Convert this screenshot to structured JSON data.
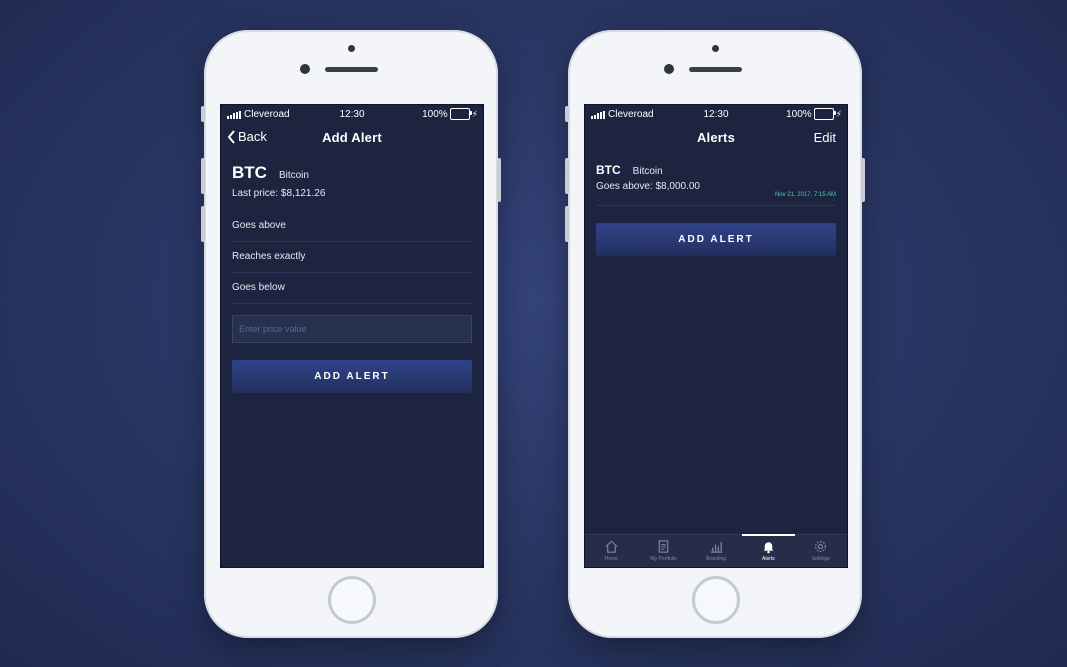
{
  "status_bar": {
    "carrier": "Cleveroad",
    "time": "12:30",
    "battery": "100%"
  },
  "add_alert_screen": {
    "nav": {
      "back_label": "Back",
      "title": "Add Alert"
    },
    "coin": {
      "ticker": "BTC",
      "name": "Bitcoin",
      "last_price": "Last price: $8,121.26"
    },
    "options": [
      "Goes above",
      "Reaches exactly",
      "Goes below"
    ],
    "price_input": {
      "placeholder": "Enter price value",
      "value": ""
    },
    "add_button": "ADD ALERT"
  },
  "alerts_screen": {
    "nav": {
      "title": "Alerts",
      "edit_label": "Edit"
    },
    "alerts": [
      {
        "ticker": "BTC",
        "name": "Bitcoin",
        "condition": "Goes above: $8,000.00",
        "date": "Nov 21, 2017, 7:15 AM"
      }
    ],
    "add_button": "ADD ALERT",
    "tabs": [
      {
        "label": "Home",
        "icon": "home-icon",
        "active": false
      },
      {
        "label": "My Portfolio",
        "icon": "portfolio-icon",
        "active": false
      },
      {
        "label": "Branding",
        "icon": "chart-icon",
        "active": false
      },
      {
        "label": "Alerts",
        "icon": "bell-icon",
        "active": true
      },
      {
        "label": "Settings",
        "icon": "gear-icon",
        "active": false
      }
    ]
  },
  "colors": {
    "background": "#2a3866",
    "screen": "#1d2440",
    "button": "#2f4189",
    "battery": "#3ecf5a",
    "date_accent": "#48d0a8"
  }
}
